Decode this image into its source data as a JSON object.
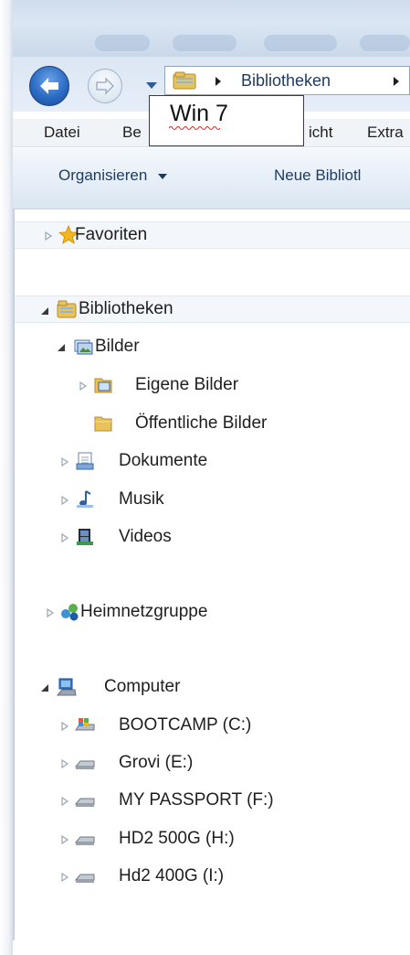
{
  "address_bar": {
    "crumbs": [
      "Bibliotheken"
    ]
  },
  "menubar": {
    "items": [
      "Datei",
      "Be",
      "icht",
      "Extra"
    ]
  },
  "annotation": {
    "text": "Win 7"
  },
  "command_bar": {
    "organize_label": "Organisieren",
    "new_library_label": "Neue Bibliotl"
  },
  "nav_tree": {
    "favorites": "Favoriten",
    "libraries": "Bibliotheken",
    "pictures": "Bilder",
    "my_pictures": "Eigene Bilder",
    "public_pictures": "Öffentliche Bilder",
    "documents": "Dokumente",
    "music": "Musik",
    "videos": "Videos",
    "homegroup": "Heimnetzgruppe",
    "computer": "Computer",
    "drives": [
      "BOOTCAMP (C:)",
      "Grovi (E:)",
      "MY PASSPORT (F:)",
      "HD2 500G (H:)",
      "Hd2 400G (I:)"
    ]
  },
  "colors": {
    "accent": "#2c6bc4",
    "folder": "#e8c35a",
    "star": "#f3b51c"
  }
}
